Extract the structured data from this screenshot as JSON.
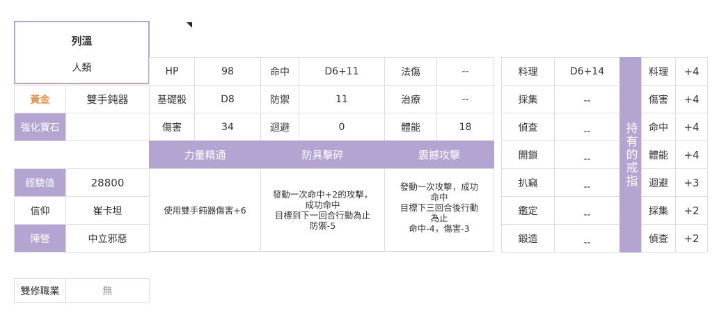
{
  "character": {
    "name": "列溫",
    "race": "人類"
  },
  "gold": {
    "label": "黃金",
    "value": "雙手鈍器"
  },
  "gem": {
    "label": "強化寶石",
    "value": ""
  },
  "stats": [
    {
      "l1": "HP",
      "v1": "98",
      "l2": "命中",
      "v2": "D6+11",
      "l3": "法傷",
      "v3": "--"
    },
    {
      "l1": "基礎骰",
      "v1": "D8",
      "l2": "防禦",
      "v2": "11",
      "l3": "治療",
      "v3": "--"
    },
    {
      "l1": "傷害",
      "v1": "34",
      "l2": "迴避",
      "v2": "0",
      "l3": "體能",
      "v3": "18"
    }
  ],
  "skills": [
    {
      "name": "力量精通",
      "desc": "使用雙手鈍器傷害+6"
    },
    {
      "name": "防具擊碎",
      "desc": "發動一次命中+2的攻擊，\n成功命中\n目標到下一回合行動為止\n防禦-5"
    },
    {
      "name": "震撼攻擊",
      "desc": "發動一次攻擊，成功\n命中\n目標下三回合後行動\n為止\n命中-4，傷害-3"
    }
  ],
  "info": [
    {
      "label": "經驗值",
      "value": "28800"
    },
    {
      "label": "信仰",
      "value": "崔卡坦"
    },
    {
      "label": "陣營",
      "value": "中立邪惡"
    }
  ],
  "dual_class": {
    "label": "雙修職業",
    "value": "無"
  },
  "life_skills": [
    {
      "label": "料理",
      "value": "D6+14"
    },
    {
      "label": "採集",
      "value": "--"
    },
    {
      "label": "偵查",
      "value": "--"
    },
    {
      "label": "開鎖",
      "value": "--"
    },
    {
      "label": "扒竊",
      "value": "--"
    },
    {
      "label": "鑑定",
      "value": "--"
    },
    {
      "label": "鍛造",
      "value": "--"
    }
  ],
  "rings": {
    "title": "持有的戒指",
    "items": [
      {
        "label": "料理",
        "value": "+4"
      },
      {
        "label": "傷害",
        "value": "+4"
      },
      {
        "label": "命中",
        "value": "+4"
      },
      {
        "label": "體能",
        "value": "+4"
      },
      {
        "label": "迴避",
        "value": "+3"
      },
      {
        "label": "採集",
        "value": "+2"
      },
      {
        "label": "偵查",
        "value": "+2"
      }
    ]
  }
}
